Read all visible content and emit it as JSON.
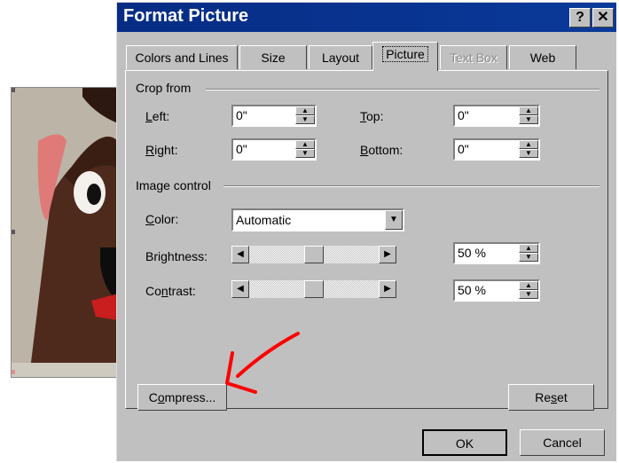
{
  "dialog": {
    "title": "Format Picture",
    "help_glyph": "?",
    "close_glyph": "✕"
  },
  "tabs": [
    {
      "label": "Colors and Lines",
      "state": "normal"
    },
    {
      "label": "Size",
      "state": "normal"
    },
    {
      "label": "Layout",
      "state": "normal"
    },
    {
      "label": "Picture",
      "state": "active"
    },
    {
      "label": "Text Box",
      "state": "disabled"
    },
    {
      "label": "Web",
      "state": "normal"
    }
  ],
  "crop": {
    "section_label": "Crop from",
    "left": {
      "label_pre": "",
      "label_u": "L",
      "label_post": "eft:",
      "value": "0\""
    },
    "right": {
      "label_pre": "",
      "label_u": "R",
      "label_post": "ight:",
      "value": "0\""
    },
    "top": {
      "label_pre": "",
      "label_u": "T",
      "label_post": "op:",
      "value": "0\""
    },
    "bottom": {
      "label_pre": "",
      "label_u": "B",
      "label_post": "ottom:",
      "value": "0\""
    }
  },
  "image_control": {
    "section_label": "Image control",
    "color": {
      "label_pre": "",
      "label_u": "C",
      "label_post": "olor:",
      "value": "Automatic"
    },
    "brightness": {
      "label_pre": "Bri",
      "label_u": "g",
      "label_post": "htness:",
      "value": "50 %",
      "level": 50
    },
    "contrast": {
      "label_pre": "Co",
      "label_u": "n",
      "label_post": "trast:",
      "value": "50 %",
      "level": 50
    }
  },
  "buttons": {
    "compress": {
      "pre": "C",
      "u": "o",
      "post": "mpress..."
    },
    "reset": {
      "pre": "Re",
      "u": "s",
      "post": "et"
    },
    "ok": "OK",
    "cancel": "Cancel"
  },
  "annotation_color": "#ff0000"
}
